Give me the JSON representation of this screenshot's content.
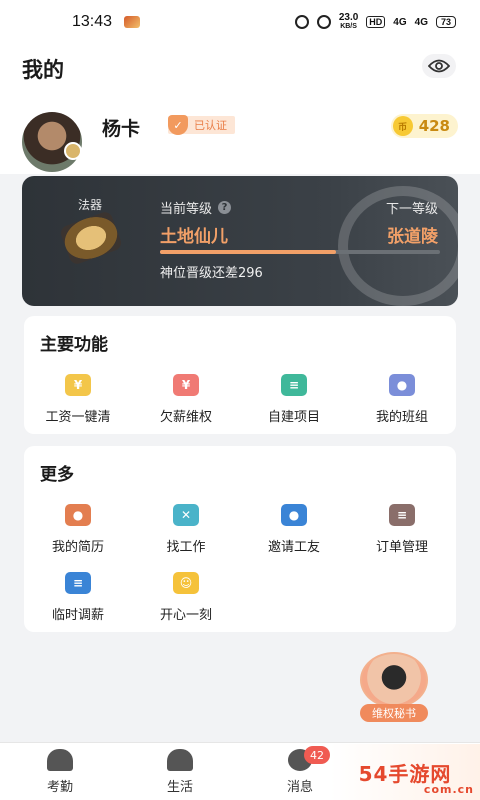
{
  "status_bar": {
    "time": "13:43",
    "speed_top": "23.0",
    "speed_bottom": "KB/S",
    "hd": "HD",
    "sig1": "4G",
    "sig2": "4G",
    "battery": "73"
  },
  "header": {
    "title": "我的",
    "username": "杨卡",
    "verified_label": "已认证",
    "coins": "428",
    "coin_icon_text": "币"
  },
  "level_card": {
    "artifact_label": "法器",
    "current_label": "当前等级",
    "next_label": "下一等级",
    "current_level": "土地仙儿",
    "next_level": "张道陵",
    "progress_fraction": 0.63,
    "promote_text": "神位晋级还差296"
  },
  "main_functions": {
    "title": "主要功能",
    "items": [
      {
        "label": "工资一键清",
        "icon": "salary-icon",
        "color": "#f3c64a",
        "glyph": "¥"
      },
      {
        "label": "欠薪维权",
        "icon": "shield-yen-icon",
        "color": "#f07a74",
        "glyph": "¥"
      },
      {
        "label": "自建项目",
        "icon": "layers-icon",
        "color": "#3fb89a",
        "glyph": "≡"
      },
      {
        "label": "我的班组",
        "icon": "team-icon",
        "color": "#7b8ed9",
        "glyph": "●"
      }
    ]
  },
  "more": {
    "title": "更多",
    "items": [
      {
        "label": "我的简历",
        "icon": "resume-icon",
        "color": "#e37e50",
        "glyph": "●"
      },
      {
        "label": "找工作",
        "icon": "tools-icon",
        "color": "#4ab3c9",
        "glyph": "✕"
      },
      {
        "label": "邀请工友",
        "icon": "invite-icon",
        "color": "#3a84d6",
        "glyph": "●"
      },
      {
        "label": "订单管理",
        "icon": "clipboard-icon",
        "color": "#8a6e6a",
        "glyph": "≡"
      },
      {
        "label": "临时调薪",
        "icon": "adjust-icon",
        "color": "#3a84d6",
        "glyph": "≡"
      },
      {
        "label": "开心一刻",
        "icon": "smile-icon",
        "color": "#f5c23a",
        "glyph": "☺"
      }
    ]
  },
  "floating": {
    "label": "维权秘书"
  },
  "tabbar": {
    "items": [
      {
        "label": "考勤"
      },
      {
        "label": "生活"
      },
      {
        "label": "消息"
      }
    ],
    "message_badge": "42"
  },
  "watermark": {
    "main": "54手游网",
    "sub": "com.cn"
  }
}
